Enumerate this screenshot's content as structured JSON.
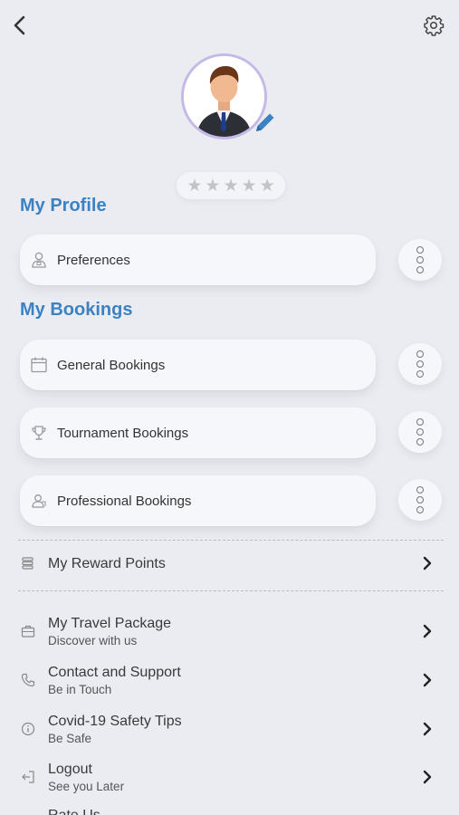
{
  "header": {
    "back_icon": "chevron-left-icon",
    "settings_icon": "gear-icon"
  },
  "profile": {
    "avatar": "businessman-avatar",
    "edit_icon": "pencil-icon",
    "rating": 0,
    "rating_max": 5
  },
  "my_profile": {
    "title": "My Profile",
    "items": [
      {
        "label": "Preferences",
        "icon": "user-preferences-icon"
      }
    ]
  },
  "my_bookings": {
    "title": "My Bookings",
    "items": [
      {
        "label": "General Bookings",
        "icon": "calendar-icon"
      },
      {
        "label": "Tournament Bookings",
        "icon": "trophy-icon"
      },
      {
        "label": "Professional Bookings",
        "icon": "professional-icon"
      }
    ]
  },
  "menu": {
    "reward": {
      "title": "My Reward Points",
      "icon": "coins-icon"
    },
    "items": [
      {
        "title": "My Travel Package",
        "subtitle": "Discover with us",
        "icon": "briefcase-icon"
      },
      {
        "title": "Contact and Support",
        "subtitle": "Be in Touch",
        "icon": "phone-icon"
      },
      {
        "title": "Covid-19 Safety Tips",
        "subtitle": "Be Safe",
        "icon": "info-icon"
      },
      {
        "title": "Logout",
        "subtitle": "See you Later",
        "icon": "logout-icon"
      },
      {
        "title": "Rate Us",
        "subtitle": "",
        "icon": "star-icon"
      }
    ]
  },
  "colors": {
    "accent": "#3b82c4",
    "background": "#ebecf2",
    "avatar_border": "#c5b9e6"
  }
}
